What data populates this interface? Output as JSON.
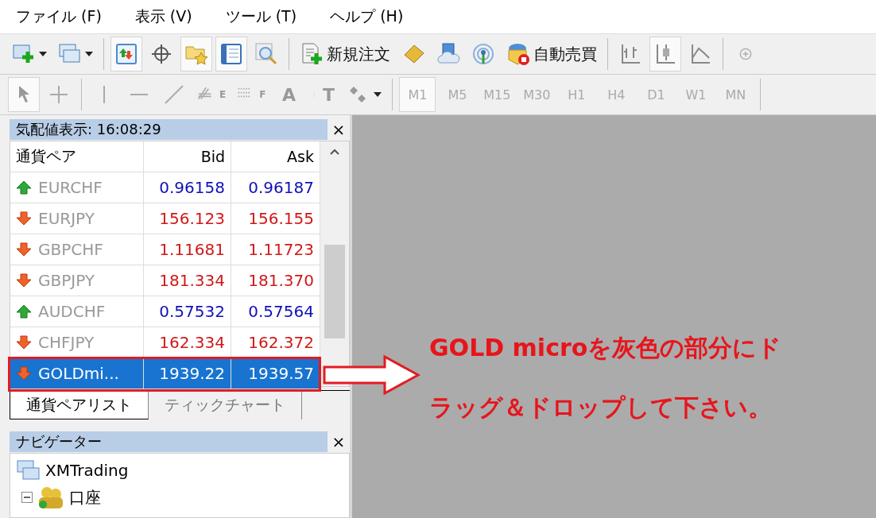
{
  "menu": [
    "ファイル (F)",
    "表示 (V)",
    "ツール (T)",
    "ヘルプ (H)"
  ],
  "toolbar": [
    {
      "kind": "new-chart",
      "dropdown": true,
      "pressed": false
    },
    {
      "kind": "profiles",
      "dropdown": true,
      "pressed": false
    },
    {
      "kind": "market-watch",
      "pressed": true
    },
    {
      "kind": "crosshair",
      "pressed": false
    },
    {
      "kind": "folder-star",
      "pressed": true
    },
    {
      "kind": "navigator",
      "pressed": true
    },
    {
      "kind": "tester",
      "pressed": false
    },
    {
      "kind": "new-order",
      "label": "新規注文",
      "pressed": false
    },
    {
      "kind": "gold",
      "pressed": false
    },
    {
      "kind": "cloud",
      "pressed": false
    },
    {
      "kind": "signal",
      "pressed": false
    },
    {
      "kind": "autotrade",
      "label": "自動売買",
      "pressed": false
    },
    {
      "kind": "bar-chart",
      "pressed": false
    },
    {
      "kind": "candle-chart",
      "pressed": true
    },
    {
      "kind": "line-chart",
      "pressed": false
    },
    {
      "kind": "zoom",
      "pressed": false
    }
  ],
  "tools": [
    {
      "kind": "cursor",
      "pressed": true
    },
    {
      "kind": "cross"
    },
    {
      "kind": "vline"
    },
    {
      "kind": "hline"
    },
    {
      "kind": "trend"
    },
    {
      "kind": "fib",
      "glyph": "E"
    },
    {
      "kind": "grid",
      "glyph": "F"
    },
    {
      "kind": "letter",
      "glyph": "A"
    },
    {
      "kind": "label",
      "glyph": "T"
    },
    {
      "kind": "shapes",
      "dropdown": true
    }
  ],
  "timeframes": [
    {
      "label": "M1",
      "selected": true
    },
    {
      "label": "M5",
      "selected": false
    },
    {
      "label": "M15",
      "selected": false
    },
    {
      "label": "M30",
      "selected": false
    },
    {
      "label": "H1",
      "selected": false
    },
    {
      "label": "H4",
      "selected": false
    },
    {
      "label": "D1",
      "selected": false
    },
    {
      "label": "W1",
      "selected": false
    },
    {
      "label": "MN",
      "selected": false
    }
  ],
  "market_watch": {
    "title": "気配値表示: 16:08:29",
    "close": "×",
    "columns": [
      "通貨ペア",
      "Bid",
      "Ask"
    ],
    "rows": [
      {
        "symbol": "EURCHF",
        "rising": true,
        "bid": "0.96158",
        "ask": "0.96187",
        "selected": false
      },
      {
        "symbol": "EURJPY",
        "rising": false,
        "bid": "156.123",
        "ask": "156.155",
        "selected": false
      },
      {
        "symbol": "GBPCHF",
        "rising": false,
        "bid": "1.11681",
        "ask": "1.11723",
        "selected": false
      },
      {
        "symbol": "GBPJPY",
        "rising": false,
        "bid": "181.334",
        "ask": "181.370",
        "selected": false
      },
      {
        "symbol": "AUDCHF",
        "rising": true,
        "bid": "0.57532",
        "ask": "0.57564",
        "selected": false
      },
      {
        "symbol": "CHFJPY",
        "rising": false,
        "bid": "162.334",
        "ask": "162.372",
        "selected": false
      },
      {
        "symbol": "GOLDmi...",
        "rising": false,
        "bid": "1939.22",
        "ask": "1939.57",
        "selected": true
      }
    ],
    "tabs": [
      {
        "label": "通貨ペアリスト",
        "selected": true
      },
      {
        "label": "ティックチャート",
        "selected": false
      }
    ]
  },
  "navigator": {
    "title": "ナビゲーター",
    "close": "×",
    "tree": [
      {
        "label": "XMTrading",
        "kind": "terminal",
        "children": [
          {
            "label": "口座",
            "kind": "accounts",
            "expanded": true
          }
        ]
      }
    ]
  },
  "annotation": {
    "lines": [
      "GOLD microを灰色の部分にド",
      "ラッグ＆ドロップして下さい。"
    ]
  }
}
